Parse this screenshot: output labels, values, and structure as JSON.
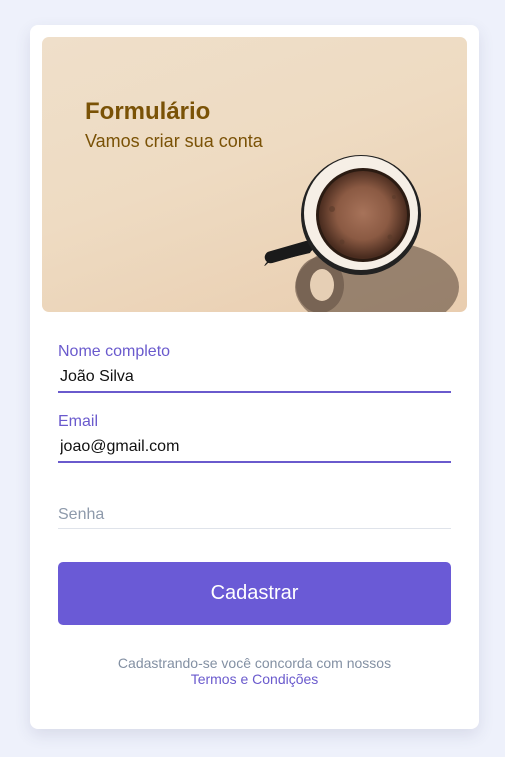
{
  "hero": {
    "title": "Formulário",
    "subtitle": "Vamos criar sua conta",
    "image_icon": "coffee-cup-icon"
  },
  "form": {
    "name": {
      "label": "Nome completo",
      "value": "João Silva"
    },
    "email": {
      "label": "Email",
      "value": "joao@gmail.com"
    },
    "password": {
      "placeholder": "Senha",
      "value": ""
    },
    "submit_label": "Cadastrar"
  },
  "footer": {
    "text": "Cadastrando-se você concorda com nossos",
    "link_label": "Termos e Condições"
  },
  "colors": {
    "accent": "#6a5acd",
    "button": "#6a5ad6",
    "hero_text": "#7a5206",
    "page_background": "#eef1fb"
  }
}
